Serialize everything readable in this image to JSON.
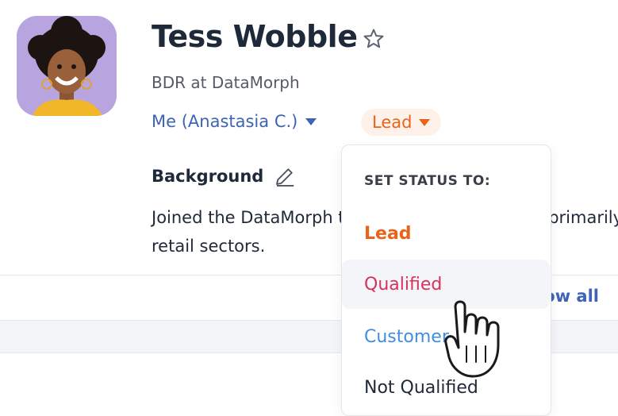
{
  "profile": {
    "name": "Tess Wobble",
    "role": "BDR at DataMorph",
    "owner_label": "Me (Anastasia C.)",
    "status_label": "Lead",
    "favorite_icon": "star-outline-icon"
  },
  "background": {
    "heading": "Background",
    "text_line1": "Joined the DataMorph team as a BDR, focusing primarily",
    "text_line2": "retail sectors."
  },
  "section": {
    "show_all_label": "Show all"
  },
  "status_menu": {
    "title": "SET STATUS TO:",
    "items": [
      {
        "label": "Lead",
        "color": "#e8641b"
      },
      {
        "label": "Qualified",
        "color": "#d6335a"
      },
      {
        "label": "Customer",
        "color": "#3f8ee0"
      },
      {
        "label": "Not Qualified",
        "color": "#1f2937"
      }
    ],
    "hovered_item": "Qualified"
  },
  "colors": {
    "accent_blue": "#3d64b5",
    "lead_orange": "#e8641b"
  }
}
